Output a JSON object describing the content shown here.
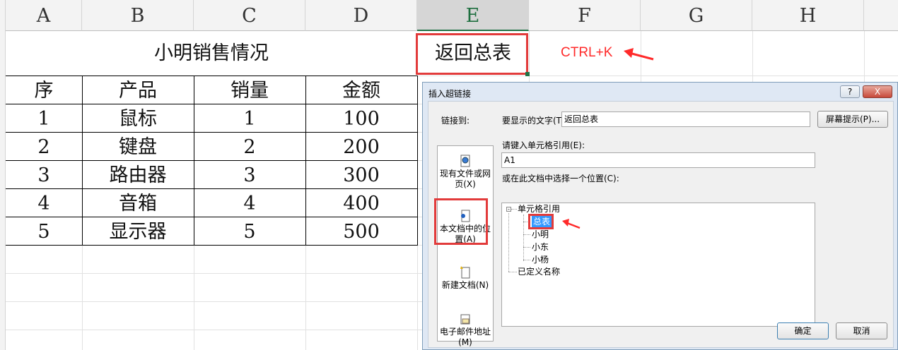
{
  "columns": [
    "A",
    "B",
    "C",
    "D",
    "E",
    "F",
    "G",
    "H"
  ],
  "sheet": {
    "title": "小明销售情况",
    "return_cell": "返回总表",
    "shortcut": "CTRL+K",
    "headers": [
      "序",
      "产品",
      "销量",
      "金额"
    ],
    "rows": [
      [
        "1",
        "鼠标",
        "1",
        "100"
      ],
      [
        "2",
        "键盘",
        "2",
        "200"
      ],
      [
        "3",
        "路由器",
        "3",
        "300"
      ],
      [
        "4",
        "音箱",
        "4",
        "400"
      ],
      [
        "5",
        "显示器",
        "5",
        "500"
      ]
    ]
  },
  "dialog": {
    "title": "插入超链接",
    "help_btn": "?",
    "close_btn": "X",
    "link_to_label": "链接到:",
    "link_options": {
      "existing": "现有文件或网页(X)",
      "this_doc": "本文档中的位置(A)",
      "new_doc": "新建文档(N)",
      "email": "电子邮件地址(M)"
    },
    "display_text_label": "要显示的文字(T):",
    "display_text_value": "返回总表",
    "screentip_btn": "屏幕提示(P)...",
    "cell_ref_label": "请键入单元格引用(E):",
    "cell_ref_value": "A1",
    "place_label": "或在此文档中选择一个位置(C):",
    "tree": {
      "root": "单元格引用",
      "items": [
        "总表",
        "小明",
        "小东",
        "小杨"
      ],
      "defined_names": "已定义名称"
    },
    "ok_btn": "确定",
    "cancel_btn": "取消"
  },
  "colors": {
    "accent_red": "#e23b3b",
    "selected_blue": "#3399ff",
    "excel_green": "#217346"
  }
}
